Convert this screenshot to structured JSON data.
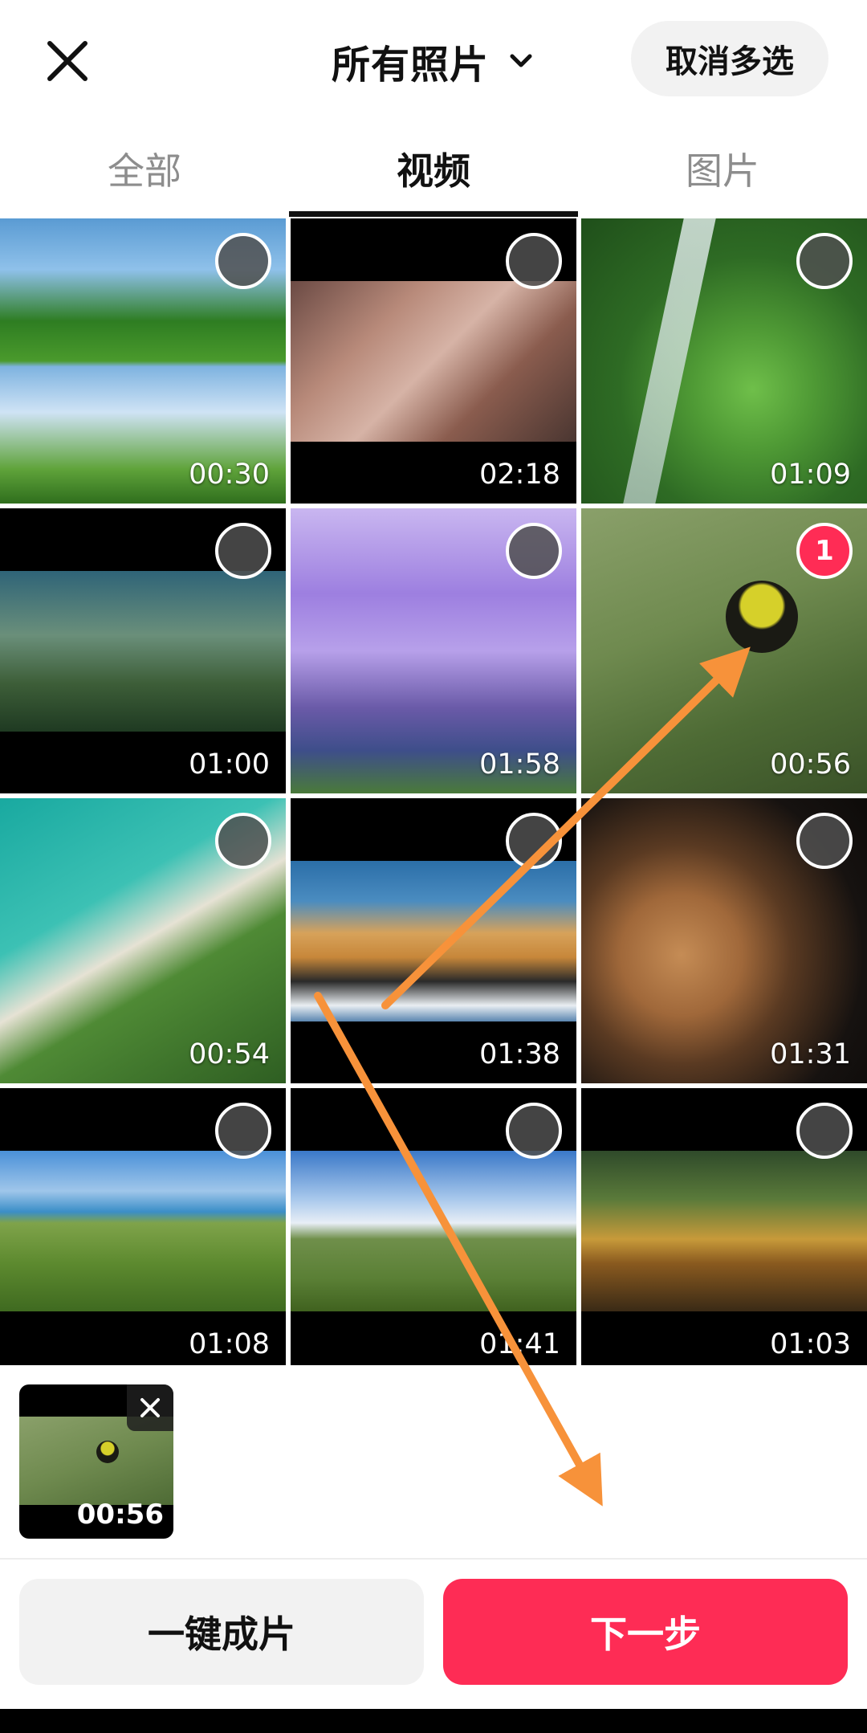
{
  "header": {
    "title": "所有照片",
    "cancel_label": "取消多选"
  },
  "tabs": [
    {
      "label": "全部",
      "active": false
    },
    {
      "label": "视频",
      "active": true
    },
    {
      "label": "图片",
      "active": false
    }
  ],
  "grid": [
    {
      "duration": "00:30",
      "selected": false,
      "badge": ""
    },
    {
      "duration": "02:18",
      "selected": false,
      "badge": ""
    },
    {
      "duration": "01:09",
      "selected": false,
      "badge": ""
    },
    {
      "duration": "01:00",
      "selected": false,
      "badge": ""
    },
    {
      "duration": "01:58",
      "selected": false,
      "badge": ""
    },
    {
      "duration": "00:56",
      "selected": true,
      "badge": "1"
    },
    {
      "duration": "00:54",
      "selected": false,
      "badge": ""
    },
    {
      "duration": "01:38",
      "selected": false,
      "badge": ""
    },
    {
      "duration": "01:31",
      "selected": false,
      "badge": ""
    },
    {
      "duration": "01:08",
      "selected": false,
      "badge": ""
    },
    {
      "duration": "01:41",
      "selected": false,
      "badge": ""
    },
    {
      "duration": "01:03",
      "selected": false,
      "badge": ""
    }
  ],
  "tray": {
    "selected_duration": "00:56"
  },
  "footer": {
    "auto_label": "一键成片",
    "next_label": "下一步"
  },
  "colors": {
    "accent": "#fe2c55",
    "annotation_arrow": "#f7923a"
  },
  "icons": [
    "close-icon",
    "chevron-down-icon",
    "remove-icon"
  ]
}
